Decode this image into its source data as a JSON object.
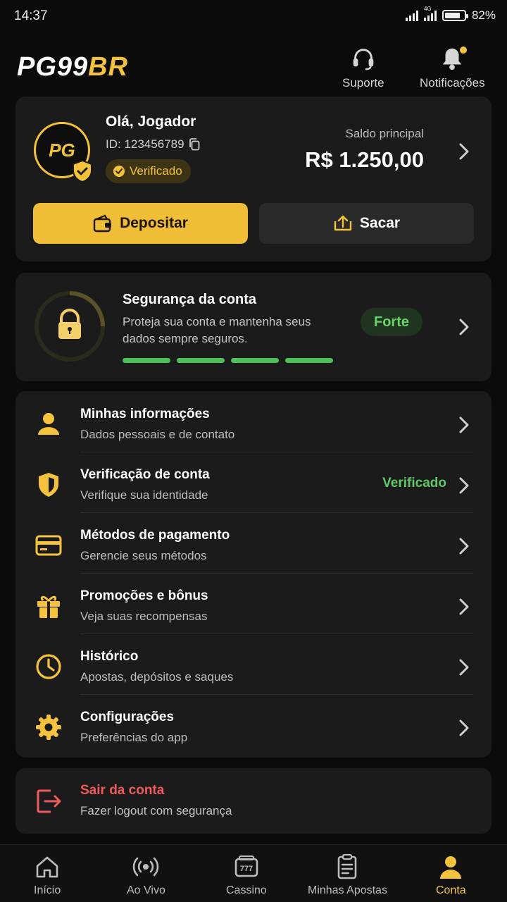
{
  "status_bar": {
    "time": "14:37",
    "battery": "82%",
    "network_label": "4G"
  },
  "header": {
    "logo_white": "PG99",
    "logo_yellow": "BR",
    "support_label": "Suporte",
    "notifications_label": "Notificações"
  },
  "profile": {
    "avatar_text": "PG",
    "greeting": "Olá, Jogador",
    "user_id": "ID: 123456789",
    "verified_label": "Verificado",
    "balance_label": "Saldo principal",
    "balance_value": "R$ 1.250,00",
    "deposit_label": "Depositar",
    "withdraw_label": "Sacar"
  },
  "security": {
    "title": "Segurança da conta",
    "description": "Proteja sua conta e mantenha seus dados sempre seguros.",
    "strength_label": "Forte",
    "strength_segments": 4
  },
  "menu": {
    "items": [
      {
        "title": "Minhas informações",
        "subtitle": "Dados pessoais e de contato",
        "icon": "user-icon",
        "status": ""
      },
      {
        "title": "Verificação de conta",
        "subtitle": "Verifique sua identidade",
        "icon": "shield-icon",
        "status": "Verificado"
      },
      {
        "title": "Métodos de pagamento",
        "subtitle": "Gerencie seus métodos",
        "icon": "credit-card-icon",
        "status": ""
      },
      {
        "title": "Promoções e bônus",
        "subtitle": "Veja suas recompensas",
        "icon": "gift-icon",
        "status": ""
      },
      {
        "title": "Histórico",
        "subtitle": "Apostas, depósitos e saques",
        "icon": "clock-icon",
        "status": ""
      },
      {
        "title": "Configurações",
        "subtitle": "Preferências do app",
        "icon": "gear-icon",
        "status": ""
      }
    ]
  },
  "logout": {
    "title": "Sair da conta",
    "subtitle": "Fazer logout com segurança"
  },
  "tabs": [
    {
      "label": "Início",
      "icon": "home-icon",
      "active": false
    },
    {
      "label": "Ao Vivo",
      "icon": "live-icon",
      "active": false
    },
    {
      "label": "Cassino",
      "icon": "slot-machine-icon",
      "active": false
    },
    {
      "label": "Minhas Apostas",
      "icon": "bet-slip-icon",
      "active": false
    },
    {
      "label": "Conta",
      "icon": "account-icon",
      "active": true
    }
  ],
  "colors": {
    "accent": "#f4c33b",
    "success": "#4cc15a",
    "danger": "#ef5b5b",
    "card": "#1b1b1b",
    "background": "#0b0b0b"
  }
}
